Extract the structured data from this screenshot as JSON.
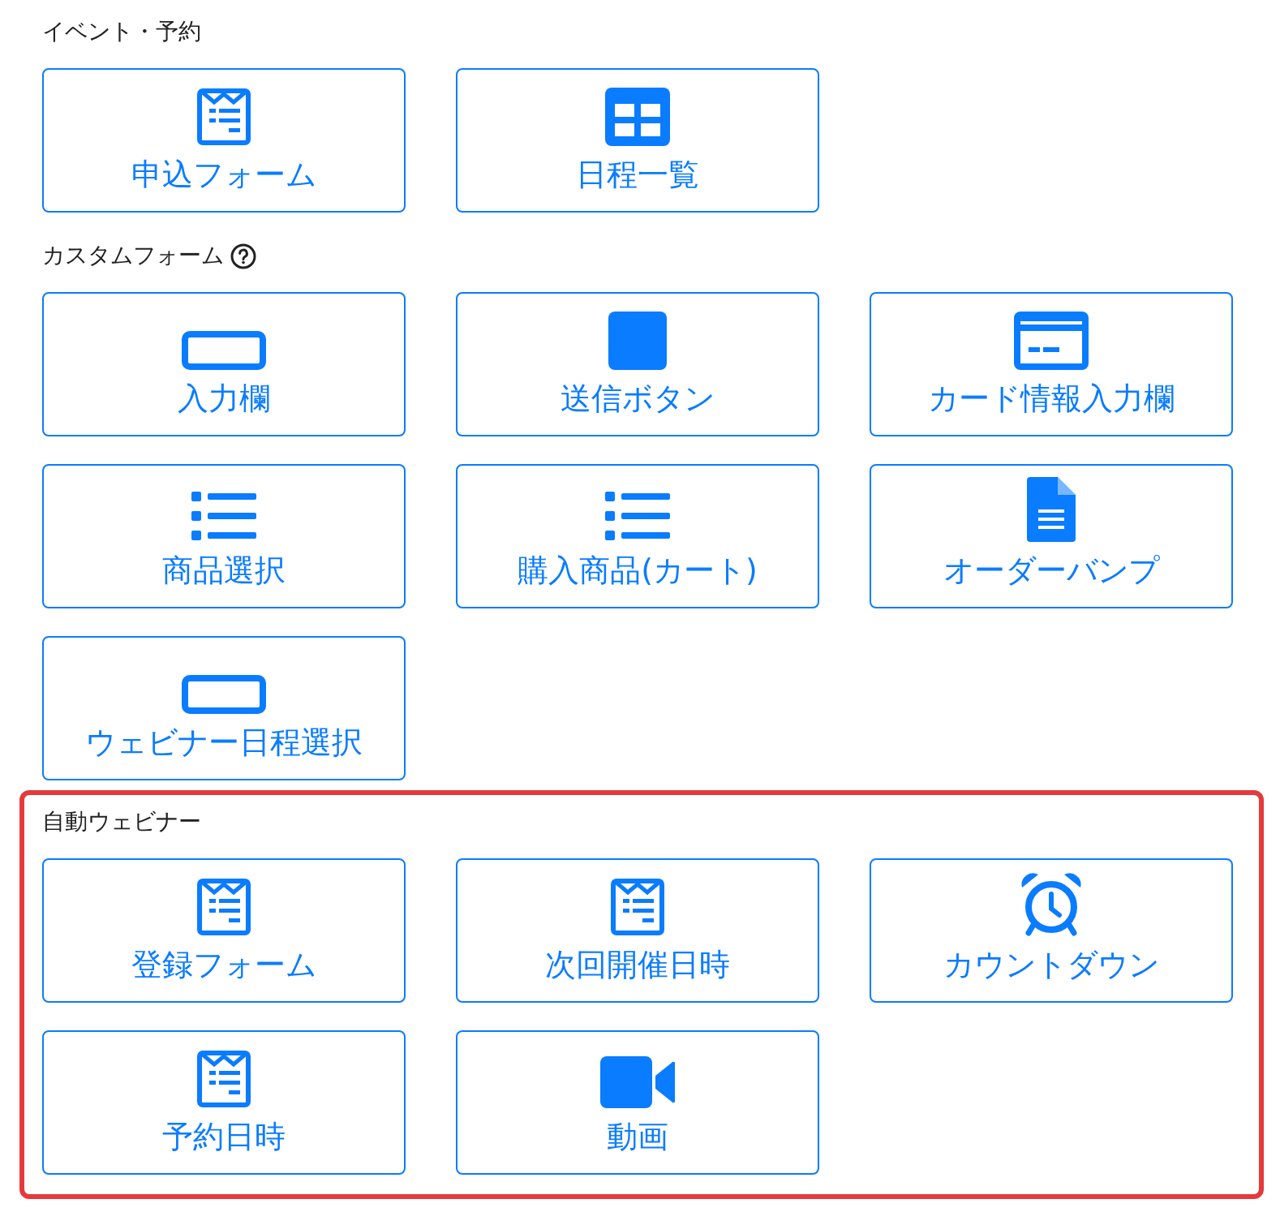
{
  "sections": [
    {
      "title": "イベント・予約",
      "help_icon": false,
      "highlighted": false,
      "items": [
        {
          "label": "申込フォーム",
          "kind": "form"
        },
        {
          "label": "日程一覧",
          "kind": "grid"
        }
      ]
    },
    {
      "title": "カスタムフォーム",
      "help_icon": true,
      "highlighted": false,
      "items": [
        {
          "label": "入力欄",
          "kind": "input"
        },
        {
          "label": "送信ボタン",
          "kind": "square"
        },
        {
          "label": "カード情報入力欄",
          "kind": "card"
        },
        {
          "label": "商品選択",
          "kind": "list"
        },
        {
          "label": "購入商品(カート)",
          "kind": "list"
        },
        {
          "label": "オーダーバンプ",
          "kind": "document"
        },
        {
          "label": "ウェビナー日程選択",
          "kind": "input"
        }
      ]
    },
    {
      "title": "自動ウェビナー",
      "help_icon": false,
      "highlighted": true,
      "items": [
        {
          "label": "登録フォーム",
          "kind": "form"
        },
        {
          "label": "次回開催日時",
          "kind": "form"
        },
        {
          "label": "カウントダウン",
          "kind": "clock"
        },
        {
          "label": "予約日時",
          "kind": "form"
        },
        {
          "label": "動画",
          "kind": "video"
        }
      ]
    }
  ]
}
